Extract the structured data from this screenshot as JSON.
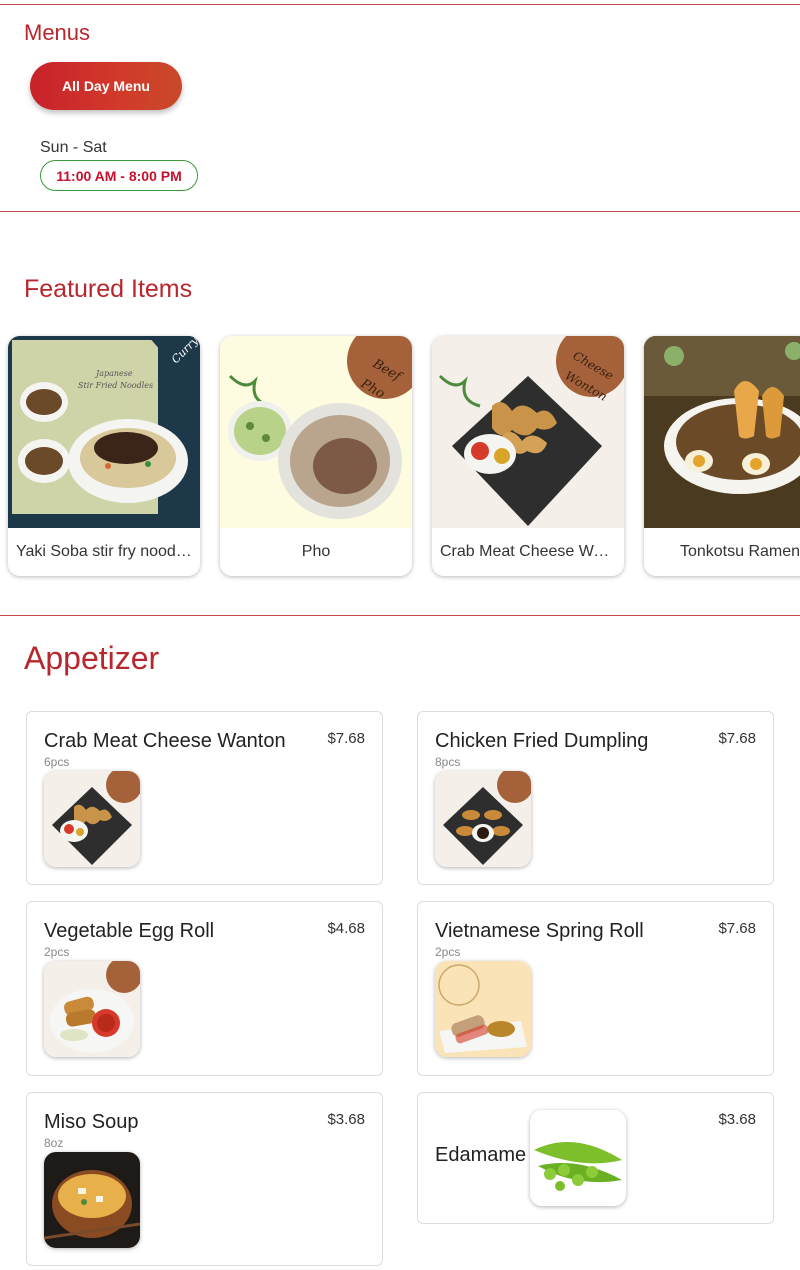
{
  "menus": {
    "title": "Menus",
    "menu_button": "All Day Menu",
    "days": "Sun - Sat",
    "hours": "11:00 AM - 8:00 PM"
  },
  "featured": {
    "title": "Featured Items",
    "items": [
      {
        "name": "Yaki Soba stir fry noodles"
      },
      {
        "name": "Pho"
      },
      {
        "name": "Crab Meat Cheese Wanton"
      },
      {
        "name": "Tonkotsu Ramen"
      }
    ]
  },
  "appetizer": {
    "title": "Appetizer",
    "items": [
      {
        "name": "Crab Meat Cheese Wanton",
        "price": "$7.68",
        "qty": "6pcs"
      },
      {
        "name": "Chicken Fried Dumpling",
        "price": "$7.68",
        "qty": "8pcs"
      },
      {
        "name": "Vegetable Egg Roll",
        "price": "$4.68",
        "qty": "2pcs"
      },
      {
        "name": "Vietnamese Spring Roll",
        "price": "$7.68",
        "qty": "2pcs"
      },
      {
        "name": "Miso Soup",
        "price": "$3.68",
        "qty": "8oz"
      },
      {
        "name": "Edamame",
        "price": "$3.68"
      }
    ]
  },
  "colors": {
    "brand_red": "#b8272d",
    "hours_border": "#3a9a3a",
    "hours_text": "#c8102e"
  }
}
